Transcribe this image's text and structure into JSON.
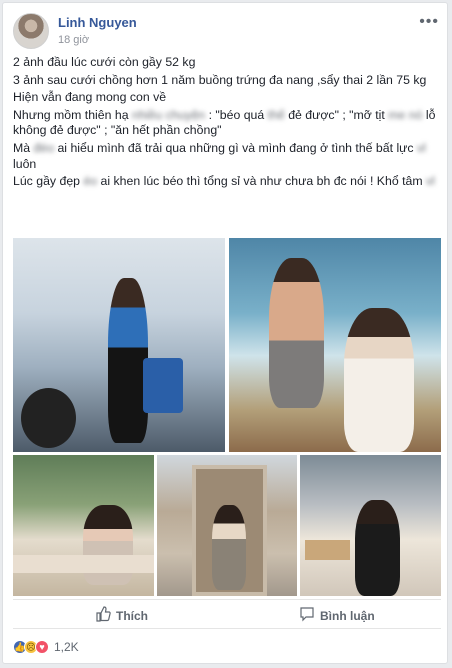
{
  "post": {
    "author": "Linh Nguyen",
    "time": "18 giờ",
    "more_label": "•••",
    "lines": {
      "l1": "2 ảnh đầu lúc cưới còn gầy 52 kg",
      "l2": "3 ảnh sau cưới chồng hơn 1 năm buồng trứng đa nang ,sẩy thai 2 lần 75 kg",
      "l3": "Hiện vẫn đang mong con về",
      "l4a": "Nhưng mồm thiên hạ",
      "l4b": "nhiều chuyện",
      "l4c": ": \"béo quá",
      "l4d": "thế",
      "l4e": "đẻ được\" ; \"mỡ tịt",
      "l4f": "me",
      "l4g": "nó",
      "l4h": "lỗ không đẻ được\" ; \"ăn hết phần chồng\"",
      "l5a": "Mà",
      "l5b": "đéo",
      "l5c": "ai hiểu mình đã trải qua những gì và mình đang ở tình thế bất lực",
      "l5d": "vl",
      "l5e": "luôn",
      "l6a": "Lúc gầy đẹp",
      "l6b": "éo",
      "l6c": "ai khen lúc béo thì tổng sỉ và như chưa bh đc nói ! Khổ",
      "l6d": "tâm",
      "l6e": "vl"
    }
  },
  "actions": {
    "like_label": "Thích",
    "comment_label": "Bình luận"
  },
  "reactions": {
    "count": "1,2K"
  }
}
